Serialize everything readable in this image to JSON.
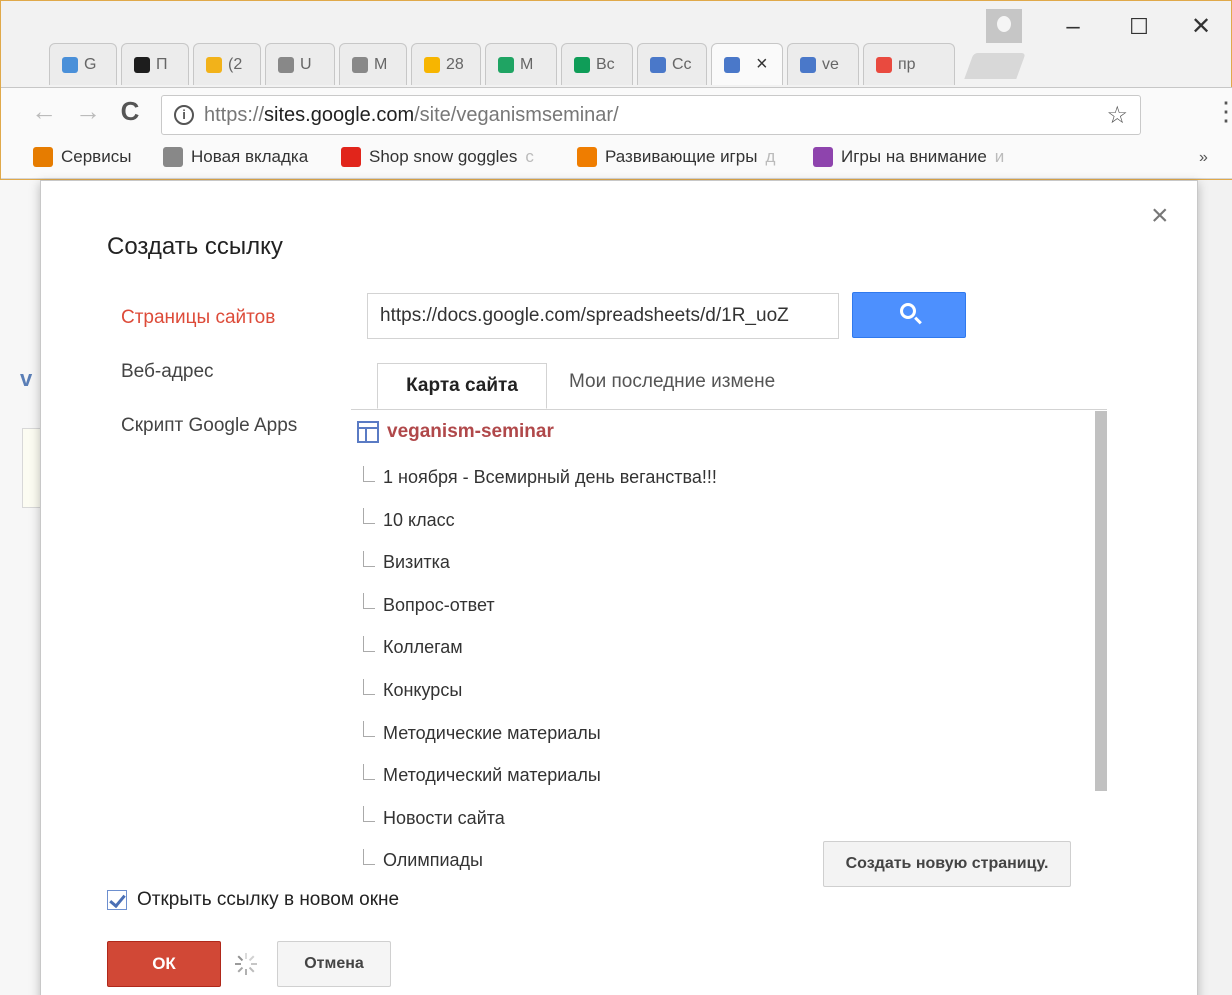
{
  "browser": {
    "tabs": [
      {
        "label": "G",
        "icon": "drop-icon",
        "color": "#4a90d9"
      },
      {
        "label": "П",
        "icon": "k-logo-icon",
        "color": "#1d1d1d"
      },
      {
        "label": "(2",
        "icon": "bag-icon",
        "color": "#f2b21a"
      },
      {
        "label": "U",
        "icon": "document-icon",
        "color": "#888888"
      },
      {
        "label": "М",
        "icon": "document-icon",
        "color": "#888888"
      },
      {
        "label": "28",
        "icon": "mail-icon",
        "color": "#f7b500"
      },
      {
        "label": "М",
        "icon": "drive-icon",
        "color": "#1fa463"
      },
      {
        "label": "Вс",
        "icon": "sheets-icon",
        "color": "#0f9d58"
      },
      {
        "label": "Сс",
        "icon": "sites-icon",
        "color": "#4a78c9"
      },
      {
        "label": "",
        "icon": "sites-icon",
        "color": "#4a78c9",
        "active": true
      },
      {
        "label": "ve",
        "icon": "sites-icon",
        "color": "#4a78c9"
      },
      {
        "label": "пр",
        "icon": "yandex-icon",
        "color": "#e94a3f"
      }
    ],
    "address": {
      "protocol": "https://",
      "host": "sites.google.com",
      "path": "/site/veganismseminar/"
    },
    "bookmarks": [
      {
        "label": "Сервисы",
        "fade": "",
        "icon": "apps-grid-icon",
        "color": "#e67c00"
      },
      {
        "label": "Новая вкладка",
        "fade": "",
        "icon": "document-icon",
        "color": "#888888"
      },
      {
        "label": "Shop snow goggles",
        "fade": "c",
        "icon": "shop-icon",
        "color": "#e1251b"
      },
      {
        "label": "Развивающие игры",
        "fade": "д",
        "icon": "game-icon",
        "color": "#ef7d00"
      },
      {
        "label": "Игры на внимание",
        "fade": "и",
        "icon": "puzzle-icon",
        "color": "#8e44ad"
      }
    ],
    "more_label": "»"
  },
  "dialog": {
    "title": "Создать ссылку",
    "close_label": "×",
    "sidebar": [
      {
        "label": "Страницы сайтов",
        "active": true
      },
      {
        "label": "Веб-адрес",
        "active": false
      },
      {
        "label": "Скрипт Google Apps",
        "active": false
      }
    ],
    "url_value": "https://docs.google.com/spreadsheets/d/1R_uoZ",
    "tabs": {
      "sitemap": "Карта сайта",
      "recent": "Мои последние измене"
    },
    "tree": {
      "root": "veganism-seminar",
      "items": [
        "1 ноября - Всемирный день веганства!!!",
        "10 класс",
        "Визитка",
        "Вопрос-ответ",
        "Коллегам",
        "Конкурсы",
        "Методические материалы",
        "Методический материалы",
        "Новости сайта",
        "Олимпиады"
      ]
    },
    "create_page_label": "Создать новую страницу.",
    "open_new_window_label": "Открыть ссылку в новом окне",
    "ok_label": "ОК",
    "cancel_label": "Отмена"
  },
  "colors": {
    "accent_red": "#dd4b39",
    "primary_blue": "#4d90fe",
    "ok_red": "#d14836"
  }
}
